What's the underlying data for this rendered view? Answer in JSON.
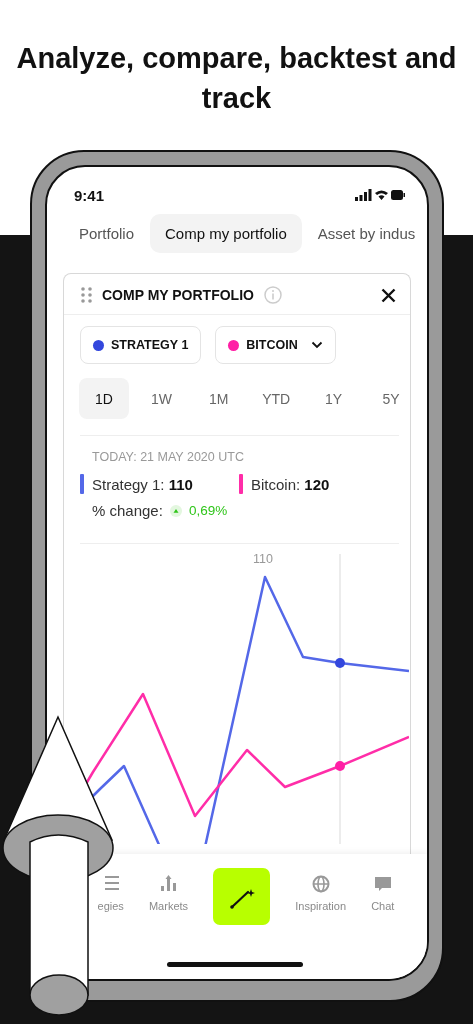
{
  "headline": "Analyze, compare, backtest and track",
  "status_bar": {
    "time": "9:41"
  },
  "tabs": [
    {
      "label": "Portfolio",
      "selected": false
    },
    {
      "label": "Comp my portfolio",
      "selected": true
    },
    {
      "label": "Asset by indus",
      "selected": false
    }
  ],
  "card": {
    "title": "COMP MY PORTFOLIO",
    "series_chips": [
      {
        "label": "STRATEGY 1",
        "color": "#3347dd",
        "dropdown": false
      },
      {
        "label": "BITCOIN",
        "color": "#ff1fa5",
        "dropdown": true
      }
    ],
    "periods": [
      {
        "label": "1D",
        "selected": true
      },
      {
        "label": "1W",
        "selected": false
      },
      {
        "label": "1M",
        "selected": false
      },
      {
        "label": "YTD",
        "selected": false
      },
      {
        "label": "1Y",
        "selected": false
      },
      {
        "label": "5Y",
        "selected": false
      }
    ],
    "date": "TODAY: 21 MAY 2020 UTC",
    "legend": [
      {
        "text": "Strategy 1: **110**",
        "color": "#5468e8"
      },
      {
        "text": "Bitcoin: **120**",
        "color": "#ff2da8"
      }
    ],
    "change_label": "% change:",
    "change_value": "0,69%",
    "change_up": true,
    "chart_label": "110"
  },
  "nav": [
    {
      "label": "egies",
      "kind": "list"
    },
    {
      "label": "Markets",
      "kind": "bars"
    },
    {
      "kind": "action"
    },
    {
      "label": "Inspiration",
      "kind": "globe"
    },
    {
      "label": "Chat",
      "kind": "chat"
    }
  ]
}
